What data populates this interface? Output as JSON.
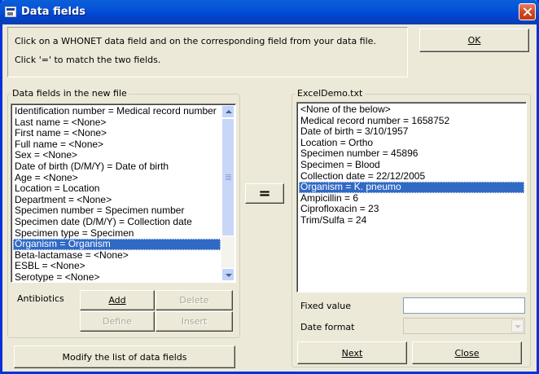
{
  "window": {
    "title": "Data fields"
  },
  "instructions": {
    "line1": "Click on a WHONET data field and on the corresponding field from your data file.",
    "line2": "Click '=' to match the two fields."
  },
  "buttons": {
    "ok": "OK",
    "equals": "=",
    "add": "Add",
    "delete": "Delete",
    "define": "Define",
    "insert": "Insert",
    "modify": "Modify the list of data fields",
    "next": "Next",
    "close": "Close"
  },
  "left_group": {
    "label": "Data fields in the new file",
    "items": [
      "Identification number = Medical record number",
      "Last name = <None>",
      "First name = <None>",
      "Full name = <None>",
      "Sex = <None>",
      "Date of birth (D/M/Y) = Date of birth",
      "Age = <None>",
      "Location = Location",
      "Department = <None>",
      "Specimen number = Specimen number",
      "Specimen date (D/M/Y) = Collection date",
      "Specimen type = Specimen",
      "Organism = Organism",
      "Beta-lactamase = <None>",
      "ESBL = <None>",
      "Serotype = <None>"
    ],
    "selected_item": "Organism = Organism"
  },
  "antibiotics": {
    "label": "Antibiotics"
  },
  "right_group": {
    "label": "ExcelDemo.txt",
    "items": [
      "<None of the below>",
      "Medical record number = 1658752",
      "Date of birth = 3/10/1957",
      "Location = Ortho",
      "Specimen number = 45896",
      "Specimen = Blood",
      "Collection date = 22/12/2005",
      "Organism = K. pneumo",
      "Ampicillin = 6",
      "Ciprofloxacin = 23",
      "Trim/Sulfa = 24"
    ],
    "selected_item": "Organism = K. pneumo",
    "fixed_value_label": "Fixed value",
    "fixed_value": "",
    "date_format_label": "Date format",
    "date_format_value": ""
  }
}
